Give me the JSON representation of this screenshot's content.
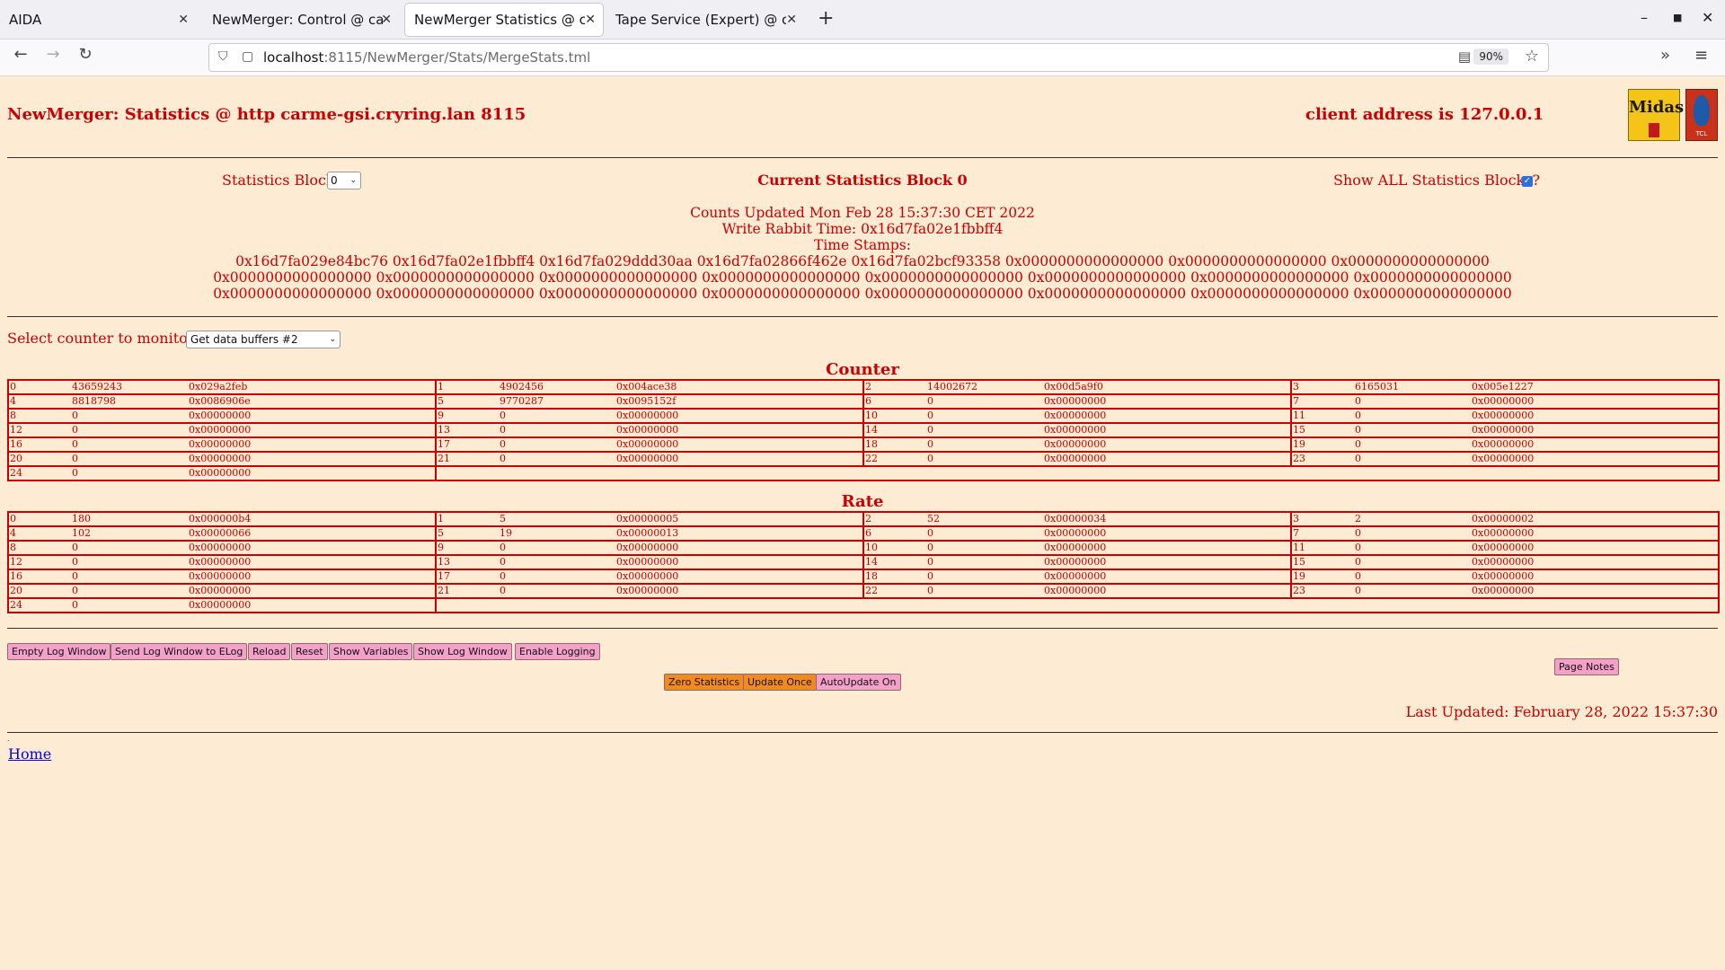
{
  "browser": {
    "tabs": [
      {
        "label": "AIDA",
        "active": false
      },
      {
        "label": "NewMerger: Control @ carme",
        "active": false
      },
      {
        "label": "NewMerger Statistics @ carm",
        "active": true
      },
      {
        "label": "Tape Service (Expert) @ carm",
        "active": false
      }
    ],
    "url_host": "localhost",
    "url_rest": ":8115/NewMerger/Stats/MergeStats.tml",
    "zoom": "90%"
  },
  "header": {
    "title": "NewMerger: Statistics @ http carme-gsi.cryring.lan 8115",
    "client": "client address is 127.0.0.1",
    "midas_logo": "Midas",
    "tcl_logo": "TCL"
  },
  "controls": {
    "stat_block_label": "Statistics Block",
    "stat_block_value": "0",
    "current_block": "Current Statistics Block 0",
    "show_all_label": "Show ALL Statistics Blocks?",
    "show_all_checked": true
  },
  "info": {
    "counts_updated": "Counts Updated Mon Feb 28 15:37:30 CET 2022",
    "write_rabbit": "Write Rabbit Time: 0x16d7fa02e1fbbff4",
    "time_stamps_label": "Time Stamps:",
    "ts_rows": [
      "0x16d7fa029e84bc76 0x16d7fa02e1fbbff4 0x16d7fa029ddd30aa 0x16d7fa02866f462e 0x16d7fa02bcf93358 0x0000000000000000 0x0000000000000000 0x0000000000000000",
      "0x0000000000000000 0x0000000000000000 0x0000000000000000 0x0000000000000000 0x0000000000000000 0x0000000000000000 0x0000000000000000 0x0000000000000000",
      "0x0000000000000000 0x0000000000000000 0x0000000000000000 0x0000000000000000 0x0000000000000000 0x0000000000000000 0x0000000000000000 0x0000000000000000"
    ]
  },
  "monitor": {
    "label": "Select counter to monitor",
    "selected": "Get data buffers #2"
  },
  "counter": {
    "title": "Counter",
    "rows": [
      [
        [
          "0",
          "43659243",
          "0x029a2feb"
        ],
        [
          "1",
          "4902456",
          "0x004ace38"
        ],
        [
          "2",
          "14002672",
          "0x00d5a9f0"
        ],
        [
          "3",
          "6165031",
          "0x005e1227"
        ]
      ],
      [
        [
          "4",
          "8818798",
          "0x0086906e"
        ],
        [
          "5",
          "9770287",
          "0x0095152f"
        ],
        [
          "6",
          "0",
          "0x00000000"
        ],
        [
          "7",
          "0",
          "0x00000000"
        ]
      ],
      [
        [
          "8",
          "0",
          "0x00000000"
        ],
        [
          "9",
          "0",
          "0x00000000"
        ],
        [
          "10",
          "0",
          "0x00000000"
        ],
        [
          "11",
          "0",
          "0x00000000"
        ]
      ],
      [
        [
          "12",
          "0",
          "0x00000000"
        ],
        [
          "13",
          "0",
          "0x00000000"
        ],
        [
          "14",
          "0",
          "0x00000000"
        ],
        [
          "15",
          "0",
          "0x00000000"
        ]
      ],
      [
        [
          "16",
          "0",
          "0x00000000"
        ],
        [
          "17",
          "0",
          "0x00000000"
        ],
        [
          "18",
          "0",
          "0x00000000"
        ],
        [
          "19",
          "0",
          "0x00000000"
        ]
      ],
      [
        [
          "20",
          "0",
          "0x00000000"
        ],
        [
          "21",
          "0",
          "0x00000000"
        ],
        [
          "22",
          "0",
          "0x00000000"
        ],
        [
          "23",
          "0",
          "0x00000000"
        ]
      ],
      [
        [
          "24",
          "0",
          "0x00000000"
        ]
      ]
    ]
  },
  "rate": {
    "title": "Rate",
    "rows": [
      [
        [
          "0",
          "180",
          "0x000000b4"
        ],
        [
          "1",
          "5",
          "0x00000005"
        ],
        [
          "2",
          "52",
          "0x00000034"
        ],
        [
          "3",
          "2",
          "0x00000002"
        ]
      ],
      [
        [
          "4",
          "102",
          "0x00000066"
        ],
        [
          "5",
          "19",
          "0x00000013"
        ],
        [
          "6",
          "0",
          "0x00000000"
        ],
        [
          "7",
          "0",
          "0x00000000"
        ]
      ],
      [
        [
          "8",
          "0",
          "0x00000000"
        ],
        [
          "9",
          "0",
          "0x00000000"
        ],
        [
          "10",
          "0",
          "0x00000000"
        ],
        [
          "11",
          "0",
          "0x00000000"
        ]
      ],
      [
        [
          "12",
          "0",
          "0x00000000"
        ],
        [
          "13",
          "0",
          "0x00000000"
        ],
        [
          "14",
          "0",
          "0x00000000"
        ],
        [
          "15",
          "0",
          "0x00000000"
        ]
      ],
      [
        [
          "16",
          "0",
          "0x00000000"
        ],
        [
          "17",
          "0",
          "0x00000000"
        ],
        [
          "18",
          "0",
          "0x00000000"
        ],
        [
          "19",
          "0",
          "0x00000000"
        ]
      ],
      [
        [
          "20",
          "0",
          "0x00000000"
        ],
        [
          "21",
          "0",
          "0x00000000"
        ],
        [
          "22",
          "0",
          "0x00000000"
        ],
        [
          "23",
          "0",
          "0x00000000"
        ]
      ],
      [
        [
          "24",
          "0",
          "0x00000000"
        ]
      ]
    ]
  },
  "buttons": {
    "empty_log": "Empty Log Window",
    "send_log": "Send Log Window to ELog",
    "reload": "Reload",
    "reset": "Reset",
    "show_vars": "Show Variables",
    "show_log": "Show Log Window",
    "enable_logging": "Enable Logging",
    "page_notes": "Page Notes",
    "zero_stats": "Zero Statistics",
    "update_once": "Update Once",
    "autoupdate": "AutoUpdate On"
  },
  "footer": {
    "last_updated": "Last Updated: February 28, 2022 15:37:30",
    "home": "Home"
  },
  "colors": {
    "page_bg": "#fdebd3",
    "text_red": "#cc0000",
    "button_pink": "#f5a0c8",
    "button_orange": "#f28a1e",
    "link_blue": "#0000ee"
  }
}
